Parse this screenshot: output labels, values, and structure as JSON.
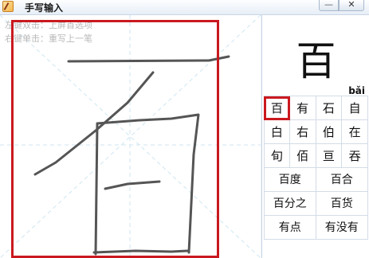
{
  "window": {
    "title": "手写输入",
    "minimize_label": "—",
    "close_label": "✕"
  },
  "hints": {
    "double_click": "左键双击：上屏首选项",
    "right_click": "右键单击：重写上一笔"
  },
  "preview": {
    "character": "百",
    "pinyin": "bǎi"
  },
  "candidates": {
    "singles": [
      [
        "百",
        "有",
        "石",
        "自"
      ],
      [
        "白",
        "右",
        "伯",
        "在"
      ],
      [
        "旬",
        "佰",
        "亘",
        "吞"
      ]
    ],
    "pairs": [
      [
        "百度",
        "百合"
      ],
      [
        "百分之",
        "百货"
      ],
      [
        "有点",
        "有没有"
      ]
    ],
    "selected": "百"
  },
  "colors": {
    "highlight_border": "#c9191f",
    "stroke": "#555555",
    "guide": "#cfe6f2"
  }
}
